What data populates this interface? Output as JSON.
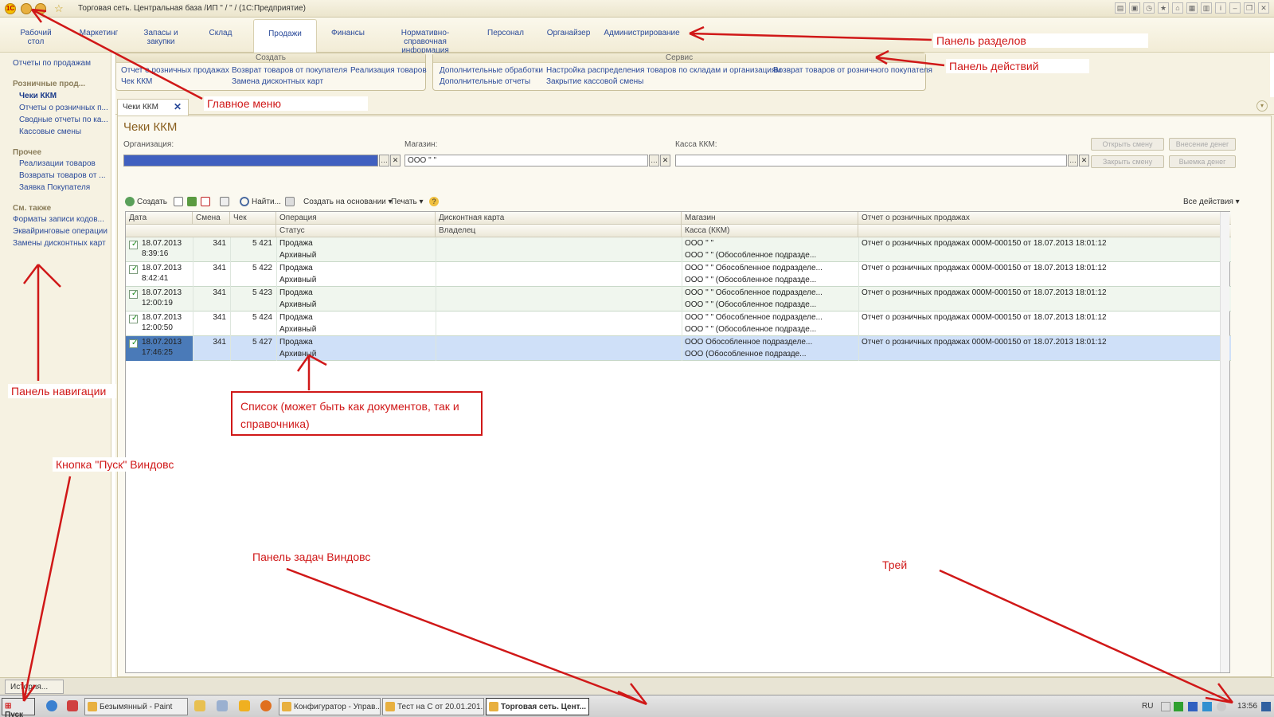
{
  "window": {
    "title": "Торговая сеть. Центральная база /ИП \"                /               \" / (1С:Предприятие)",
    "logo": "1С"
  },
  "sections": [
    {
      "label": "Рабочий стол",
      "active": false
    },
    {
      "label": "Маркетинг",
      "active": false
    },
    {
      "label": "Запасы и закупки",
      "active": false
    },
    {
      "label": "Склад",
      "active": false
    },
    {
      "label": "Продажи",
      "active": true
    },
    {
      "label": "Финансы",
      "active": false
    },
    {
      "label": "Нормативно-справочная информация",
      "active": false
    },
    {
      "label": "Персонал",
      "active": false
    },
    {
      "label": "Органайзер",
      "active": false
    },
    {
      "label": "Администрирование",
      "active": false
    }
  ],
  "actions": {
    "create_title": "Создать",
    "create_links": [
      "Отчет о розничных продажах",
      "Чек ККМ",
      "Возврат товаров от покупателя",
      "Замена дисконтных карт",
      "Реализация товаров"
    ],
    "service_title": "Сервис",
    "service_links": [
      "Дополнительные обработки",
      "Дополнительные отчеты",
      "Настройка распределения товаров по складам и организациям",
      "Закрытие кассовой смены",
      "Возврат товаров от розничного покупателя"
    ]
  },
  "nav": {
    "top_link": "Отчеты по продажам",
    "group1": "Розничные прод...",
    "group1_items": [
      "Чеки ККМ",
      "Отчеты о розничных п...",
      "Сводные отчеты по ка...",
      "Кассовые смены"
    ],
    "group2": "Прочее",
    "group2_items": [
      "Реализации товаров",
      "Возвраты товаров от ...",
      "Заявка Покупателя"
    ],
    "group3": "См. также",
    "group3_items": [
      "Форматы записи кодов...",
      "Эквайринговые операции",
      "Замены дисконтных карт"
    ]
  },
  "form": {
    "tab_label": "Чеки ККМ",
    "title": "Чеки ККМ",
    "org_label": "Организация:",
    "store_label": "Магазин:",
    "store_value": "ООО \"               \"",
    "kkm_label": "Касса ККМ:",
    "btn_open_shift": "Открыть смену",
    "btn_deposit": "Внесение денег",
    "btn_close_shift": "Закрыть смену",
    "btn_withdraw": "Выемка денег"
  },
  "commands": {
    "create": "Создать",
    "find": "Найти...",
    "create_based": "Создать на основании",
    "print": "Печать",
    "all_actions": "Все действия",
    "help": "?"
  },
  "table": {
    "headers_top": [
      "Дата",
      "Смена",
      "Чек",
      "Операция",
      "Дисконтная карта",
      "Магазин",
      "Отчет о розничных продажах"
    ],
    "headers_bottom": [
      "Статус",
      "Владелец",
      "Касса (ККМ)"
    ],
    "rows": [
      {
        "date": "18.07.2013",
        "time": "8:39:16",
        "shift": "341",
        "check": "5 421",
        "operation": "Продажа",
        "status": "Архивный",
        "card": "",
        "owner": "",
        "store": "ООО \"          \"",
        "kkm": "ООО \"            \" (Обособленное подразде...",
        "report": "Отчет о розничных продажах 000М-000150 от 18.07.2013 18:01:12"
      },
      {
        "date": "18.07.2013",
        "time": "8:42:41",
        "shift": "341",
        "check": "5 422",
        "operation": "Продажа",
        "status": "Архивный",
        "card": "",
        "owner": "",
        "store": "ООО \"          \" Обособленное подразделе...",
        "kkm": "ООО \"            \" (Обособленное подразде...",
        "report": "Отчет о розничных продажах 000М-000150 от 18.07.2013 18:01:12"
      },
      {
        "date": "18.07.2013",
        "time": "12:00:19",
        "shift": "341",
        "check": "5 423",
        "operation": "Продажа",
        "status": "Архивный",
        "card": "",
        "owner": "",
        "store": "ООО \"          \" Обособленное подразделе...",
        "kkm": "ООО \"            \" (Обособленное подразде...",
        "report": "Отчет о розничных продажах 000М-000150 от 18.07.2013 18:01:12"
      },
      {
        "date": "18.07.2013",
        "time": "12:00:50",
        "shift": "341",
        "check": "5 424",
        "operation": "Продажа",
        "status": "Архивный",
        "card": "",
        "owner": "",
        "store": "ООО \"          \" Обособленное подразделе...",
        "kkm": "ООО \"            \" (Обособленное подразде...",
        "report": "Отчет о розничных продажах 000М-000150 от 18.07.2013 18:01:12"
      },
      {
        "date": "18.07.2013",
        "time": "17:46:25",
        "shift": "341",
        "check": "5 427",
        "operation": "Продажа",
        "status": "Архивный",
        "card": "",
        "owner": "",
        "store": "ООО            Обособленное подразделе...",
        "kkm": "ООО             (Обособленное подразде...",
        "report": "Отчет о розничных продажах 000М-000150 от 18.07.2013 18:01:12"
      }
    ]
  },
  "bottom": {
    "history": "История..."
  },
  "taskbar": {
    "start": "Пуск",
    "tasks": [
      "Безымянный - Paint",
      "Конфигуратор - Управ...",
      "Тест на С от 20.01.201...",
      "Торговая сеть. Цент..."
    ],
    "tray_lang": "RU",
    "tray_time": "13:56"
  },
  "annotations": {
    "main_menu": "Главное меню",
    "sections_panel": "Панель разделов",
    "actions_panel": "Панель действий",
    "nav_panel": "Панель навигации",
    "list": "Список (может быть как документов, так и справочника)",
    "start_button": "Кнопка \"Пуск\" Виндовс",
    "taskbar": "Панель задач Виндовс",
    "tray": "Трей"
  },
  "colors": {
    "annotation": "#d01818",
    "selected_row": "#cfe0f8",
    "alt_row": "#f0f6ee"
  }
}
